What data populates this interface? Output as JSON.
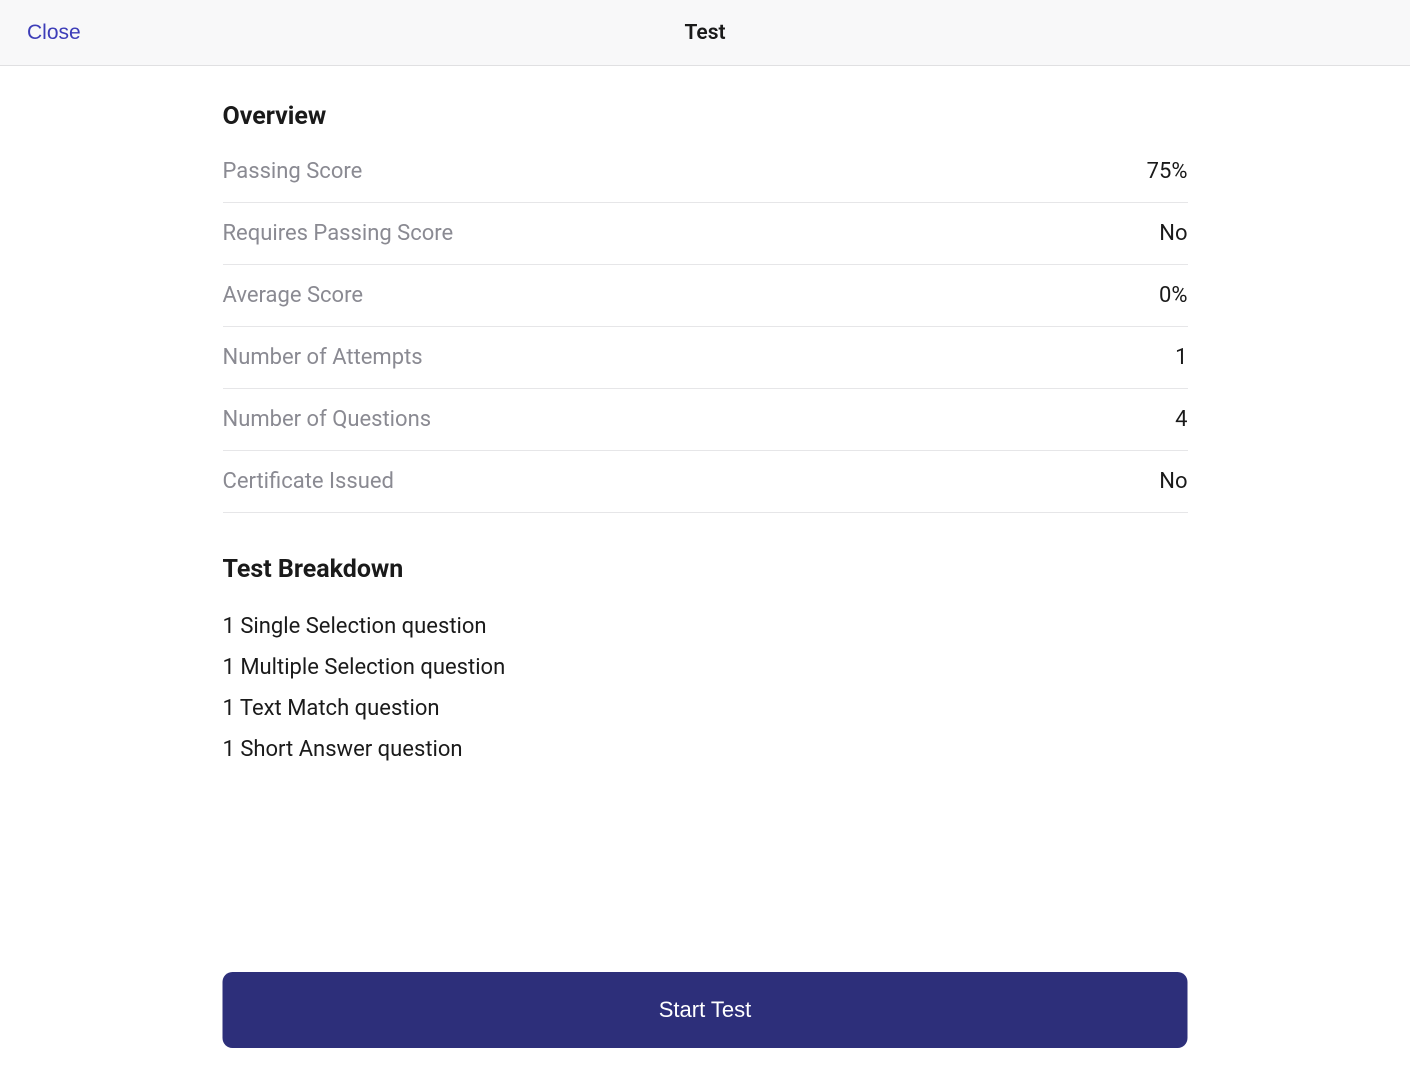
{
  "header": {
    "close_label": "Close",
    "title": "Test"
  },
  "overview": {
    "title": "Overview",
    "rows": [
      {
        "label": "Passing Score",
        "value": "75%"
      },
      {
        "label": "Requires Passing Score",
        "value": "No"
      },
      {
        "label": "Average Score",
        "value": "0%"
      },
      {
        "label": "Number of Attempts",
        "value": "1"
      },
      {
        "label": "Number of Questions",
        "value": "4"
      },
      {
        "label": "Certificate Issued",
        "value": "No"
      }
    ]
  },
  "breakdown": {
    "title": "Test Breakdown",
    "items": [
      "1 Single Selection question",
      "1 Multiple Selection question",
      "1 Text Match question",
      "1 Short Answer question"
    ]
  },
  "footer": {
    "start_label": "Start Test"
  }
}
